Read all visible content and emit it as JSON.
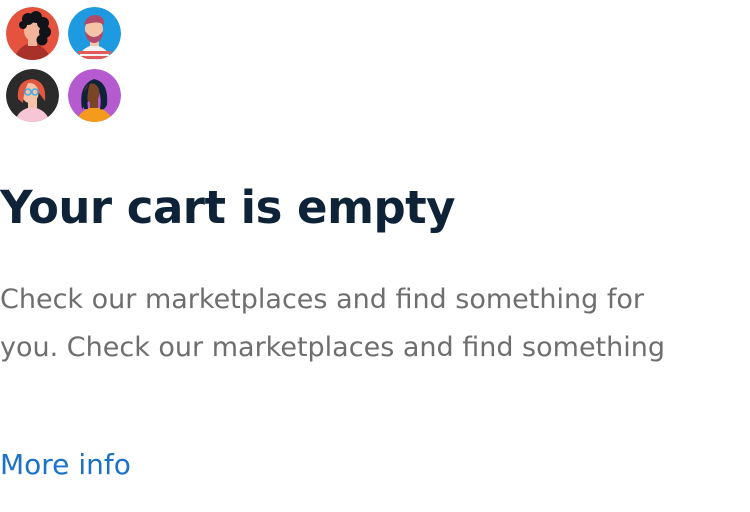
{
  "avatars": [
    {
      "icon": "person-avatar-icon",
      "bg": "#e5533f"
    },
    {
      "icon": "person-avatar-icon",
      "bg": "#1e9be0"
    },
    {
      "icon": "person-avatar-icon",
      "bg": "#2b2b2b"
    },
    {
      "icon": "person-avatar-icon",
      "bg": "#b65ad0"
    }
  ],
  "empty_state": {
    "title": "Your cart is empty",
    "description": "Check our marketplaces and find something for you. Check our marketplaces and find something",
    "link_label": "More info"
  },
  "colors": {
    "title": "#0f2338",
    "description": "#6e6e6e",
    "link": "#1b73c9"
  }
}
